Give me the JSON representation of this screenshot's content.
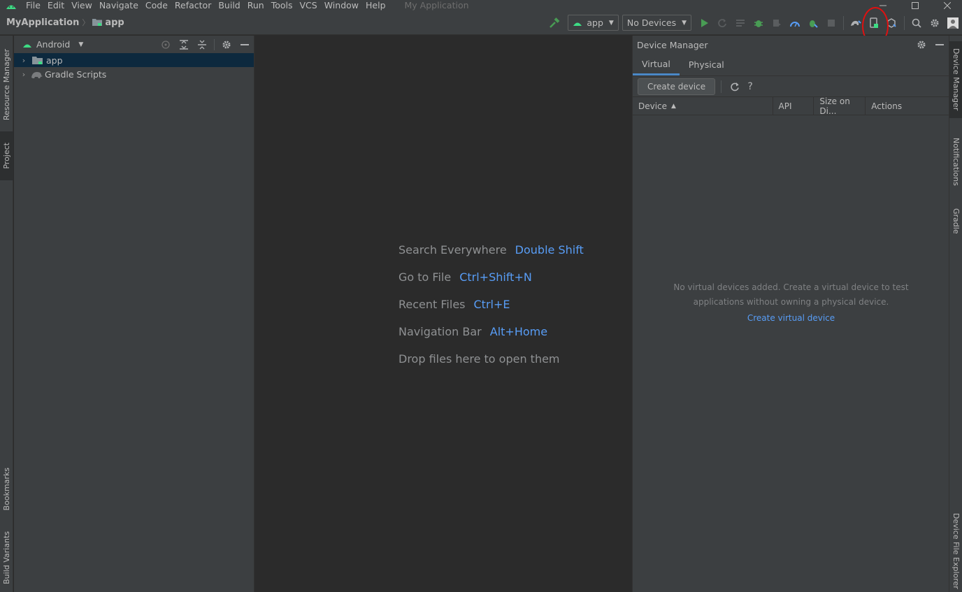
{
  "menubar": {
    "items": [
      "File",
      "Edit",
      "View",
      "Navigate",
      "Code",
      "Refactor",
      "Build",
      "Run",
      "Tools",
      "VCS",
      "Window",
      "Help"
    ],
    "window_title": "My Application"
  },
  "toolbar": {
    "breadcrumb_project": "MyApplication",
    "breadcrumb_module": "app",
    "run_config": "app",
    "device_selector": "No Devices"
  },
  "left_stripe": {
    "tabs": [
      "Resource Manager",
      "Project",
      "Bookmarks",
      "Build Variants"
    ]
  },
  "right_stripe": {
    "tabs": [
      "Device Manager",
      "Notifications",
      "Gradle",
      "Device File Explorer"
    ]
  },
  "project_panel": {
    "view_mode": "Android",
    "tree": [
      {
        "label": "app",
        "selected": true,
        "icon": "folder-module-icon"
      },
      {
        "label": "Gradle Scripts",
        "selected": false,
        "icon": "gradle-elephant-icon"
      }
    ]
  },
  "editor": {
    "hints": [
      {
        "action": "Search Everywhere",
        "key": "Double Shift"
      },
      {
        "action": "Go to File",
        "key": "Ctrl+Shift+N"
      },
      {
        "action": "Recent Files",
        "key": "Ctrl+E"
      },
      {
        "action": "Navigation Bar",
        "key": "Alt+Home"
      },
      {
        "action": "Drop files here to open them",
        "key": ""
      }
    ]
  },
  "device_manager": {
    "title": "Device Manager",
    "tabs": [
      "Virtual",
      "Physical"
    ],
    "active_tab": "Virtual",
    "create_button": "Create device",
    "help_label": "?",
    "columns": [
      "Device",
      "API",
      "Size on Di...",
      "Actions"
    ],
    "empty_line1": "No virtual devices added. Create a virtual device to test",
    "empty_line2": "applications without owning a physical device.",
    "empty_link": "Create virtual device"
  },
  "colors": {
    "accent": "#589df6",
    "android_green": "#3ddc84",
    "run_green": "#499c54",
    "annotation_red": "#e01010"
  }
}
